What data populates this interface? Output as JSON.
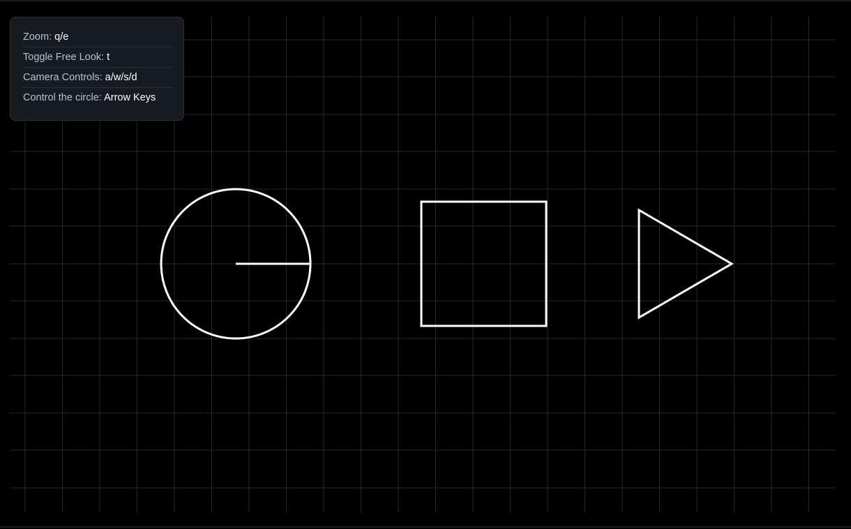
{
  "help": {
    "items": [
      {
        "label": "Zoom:",
        "key": "q/e"
      },
      {
        "label": "Toggle Free Look:",
        "key": "t"
      },
      {
        "label": "Camera Controls:",
        "key": "a/w/s/d"
      },
      {
        "label": "Control the circle:",
        "key": "Arrow Keys"
      }
    ]
  },
  "colors": {
    "background": "#000000",
    "grid_line": "#2a2a2a",
    "shape_stroke": "#ffffff",
    "panel_background": "#161b22",
    "panel_text": "#b9c1ca",
    "panel_key_text": "#ffffff"
  },
  "scene": {
    "shapes": [
      "circle",
      "square",
      "triangle"
    ],
    "circle_heading": "right"
  }
}
